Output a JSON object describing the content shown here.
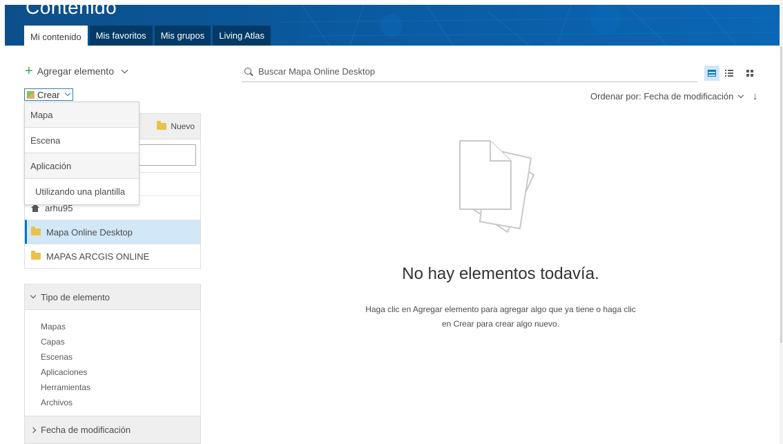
{
  "banner": {
    "title": "Contenido",
    "tabs": [
      "Mi contenido",
      "Mis favoritos",
      "Mis grupos",
      "Living Atlas"
    ],
    "active_tab": "Mi contenido"
  },
  "toolbar": {
    "add_item_label": "Agregar elemento",
    "create_label": "Crear"
  },
  "create_menu": {
    "items": [
      "Mapa",
      "Escena",
      "Aplicación"
    ],
    "template_item": "Utilizando una plantilla"
  },
  "folders": {
    "new_label": "Nuevo",
    "items": [
      {
        "label": "arhu95",
        "icon": "home-icon",
        "selected": false
      },
      {
        "label": "Mapa Online Desktop",
        "icon": "folder-icon",
        "selected": true
      },
      {
        "label": "MAPAS ARCGIS ONLINE",
        "icon": "folder-icon",
        "selected": false
      }
    ]
  },
  "filters": {
    "type_heading": "Tipo de elemento",
    "types": [
      "Mapas",
      "Capas",
      "Escenas",
      "Aplicaciones",
      "Herramientas",
      "Archivos"
    ],
    "date_heading": "Fecha de modificación"
  },
  "search": {
    "placeholder": "Buscar Mapa Online Desktop"
  },
  "sort": {
    "label": "Ordenar por: Fecha de modificación",
    "direction_icon": "arrow-down-icon"
  },
  "empty_state": {
    "title": "No hay elementos todavía.",
    "line1": "Haga clic en Agregar elemento para agregar algo que ya tiene o haga clic",
    "line2": "en Crear para crear algo nuevo."
  },
  "colors": {
    "banner": "#0a5aa0",
    "accent": "#0079c1",
    "selected_row": "#d2e7f7",
    "add_icon": "#35ac46",
    "folder": "#e9c349"
  }
}
